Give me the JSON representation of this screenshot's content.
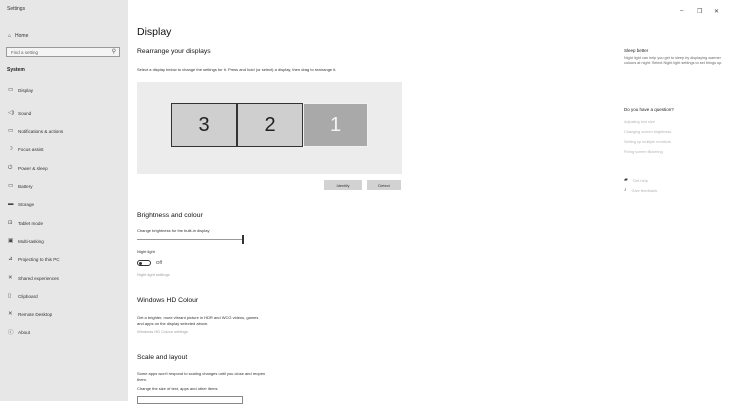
{
  "window": {
    "title": "Settings",
    "controls": [
      "–",
      "❐",
      "✕"
    ]
  },
  "sidebar": {
    "home": {
      "icon": "home-icon",
      "glyph": "⌂",
      "label": "Home"
    },
    "search_placeholder": "Find a setting",
    "search_icon": "⚲",
    "section": "System",
    "items": [
      {
        "id": "display",
        "icon": "monitor-icon",
        "glyph": "▭",
        "label": "Display"
      },
      {
        "id": "sound",
        "icon": "speaker-icon",
        "glyph": "◁)",
        "label": "Sound"
      },
      {
        "id": "notifications",
        "icon": "notifications-icon",
        "glyph": "▭",
        "label": "Notifications & actions"
      },
      {
        "id": "focus",
        "icon": "moon-icon",
        "glyph": "☽",
        "label": "Focus assist"
      },
      {
        "id": "power",
        "icon": "power-icon",
        "glyph": "⏻",
        "label": "Power & sleep"
      },
      {
        "id": "battery",
        "icon": "battery-icon",
        "glyph": "▭",
        "label": "Battery"
      },
      {
        "id": "storage",
        "icon": "storage-icon",
        "glyph": "▬",
        "label": "Storage"
      },
      {
        "id": "tablet",
        "icon": "tablet-icon",
        "glyph": "⊡",
        "label": "Tablet mode"
      },
      {
        "id": "multitasking",
        "icon": "multitasking-icon",
        "glyph": "▣",
        "label": "Multi-tasking"
      },
      {
        "id": "projecting",
        "icon": "projector-icon",
        "glyph": "⊿",
        "label": "Projecting to this PC"
      },
      {
        "id": "shared",
        "icon": "shared-experiences-icon",
        "glyph": "✕",
        "label": "Shared experiences"
      },
      {
        "id": "clipboard",
        "icon": "clipboard-icon",
        "glyph": "▯",
        "label": "Clipboard"
      },
      {
        "id": "remote",
        "icon": "remote-desktop-icon",
        "glyph": "✕",
        "label": "Remote Desktop"
      },
      {
        "id": "about",
        "icon": "info-icon",
        "glyph": "ⓘ",
        "label": "About"
      }
    ]
  },
  "main": {
    "title": "Display",
    "rearrange": {
      "heading": "Rearrange your displays",
      "description": "Select a display below to change the settings for it. Press and hold (or select) a display, then drag to rearrange it.",
      "displays": [
        "3",
        "2",
        "1"
      ],
      "identify": "Identify",
      "detect": "Detect"
    },
    "brightness": {
      "heading": "Brightness and colour",
      "slider_label": "Change brightness for the built-in display",
      "slider_value_percent": 100,
      "night_light_label": "Night light",
      "night_light_state": "Off",
      "night_light_link": "Night light settings"
    },
    "hdr": {
      "heading": "Windows HD Colour",
      "description_line1": "Get a brighter, more vibrant picture in HDR and WCG videos, games",
      "description_line2": "and apps on the display selected above.",
      "link": "Windows HD Colour settings"
    },
    "scale": {
      "heading": "Scale and layout",
      "note_line1": "Some apps won't respond to scaling changes until you close and reopen",
      "note_line2": "them.",
      "label": "Change the size of text, apps and other items"
    }
  },
  "right_panel": {
    "sleep_heading": "Sleep better",
    "sleep_text": "Night light can help you get to sleep by displaying warmer colours at night. Select Night light settings to set things up.",
    "question_heading": "Do you have a question?",
    "help_links": [
      "Adjusting font size",
      "Changing screen brightness",
      "Setting up multiple monitors",
      "Fixing screen flickering"
    ],
    "get_help": {
      "icon": "help-chat-icon",
      "glyph": "▰",
      "label": "Get help"
    },
    "feedback": {
      "icon": "feedback-icon",
      "glyph": "♪",
      "label": "Give feedback"
    }
  }
}
